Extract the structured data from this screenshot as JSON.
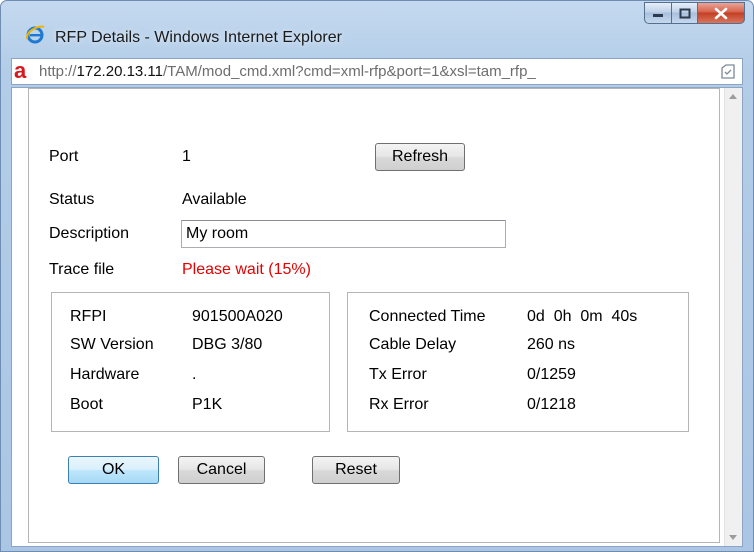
{
  "window": {
    "title": "RFP Details - Windows Internet Explorer",
    "url_prefix": "http://",
    "url_host": "172.20.13.11",
    "url_rest": "/TAM/mod_cmd.xml?cmd=xml-rfp&port=1&xsl=tam_rfp_",
    "url_favicon": "a",
    "icons": {
      "browser": "internet-explorer-icon",
      "minimize": "minimize-icon",
      "maximize": "maximize-icon",
      "close": "close-icon",
      "compat": "compatibility-view-icon"
    }
  },
  "form": {
    "port_label": "Port",
    "port_value": "1",
    "refresh_label": "Refresh",
    "status_label": "Status",
    "status_value": "Available",
    "description_label": "Description",
    "description_value": "My room",
    "trace_label": "Trace file",
    "trace_value": "Please wait (15%)"
  },
  "left_box": [
    {
      "label": "RFPI",
      "value": "901500A020"
    },
    {
      "label": "SW Version",
      "value": "DBG 3/80"
    },
    {
      "label": "Hardware",
      "value": "."
    },
    {
      "label": "Boot",
      "value": "P1K"
    }
  ],
  "right_box": [
    {
      "label": "Connected Time",
      "value": "0d  0h  0m  40s"
    },
    {
      "label": "Cable Delay",
      "value": "260 ns"
    },
    {
      "label": "Tx Error",
      "value": "0/1259"
    },
    {
      "label": "Rx Error",
      "value": "0/1218"
    }
  ],
  "buttons": {
    "ok": "OK",
    "cancel": "Cancel",
    "reset": "Reset"
  },
  "colors": {
    "trace_status": "#e60000",
    "favicon": "#d8161b",
    "close_button": "#c33f23"
  }
}
